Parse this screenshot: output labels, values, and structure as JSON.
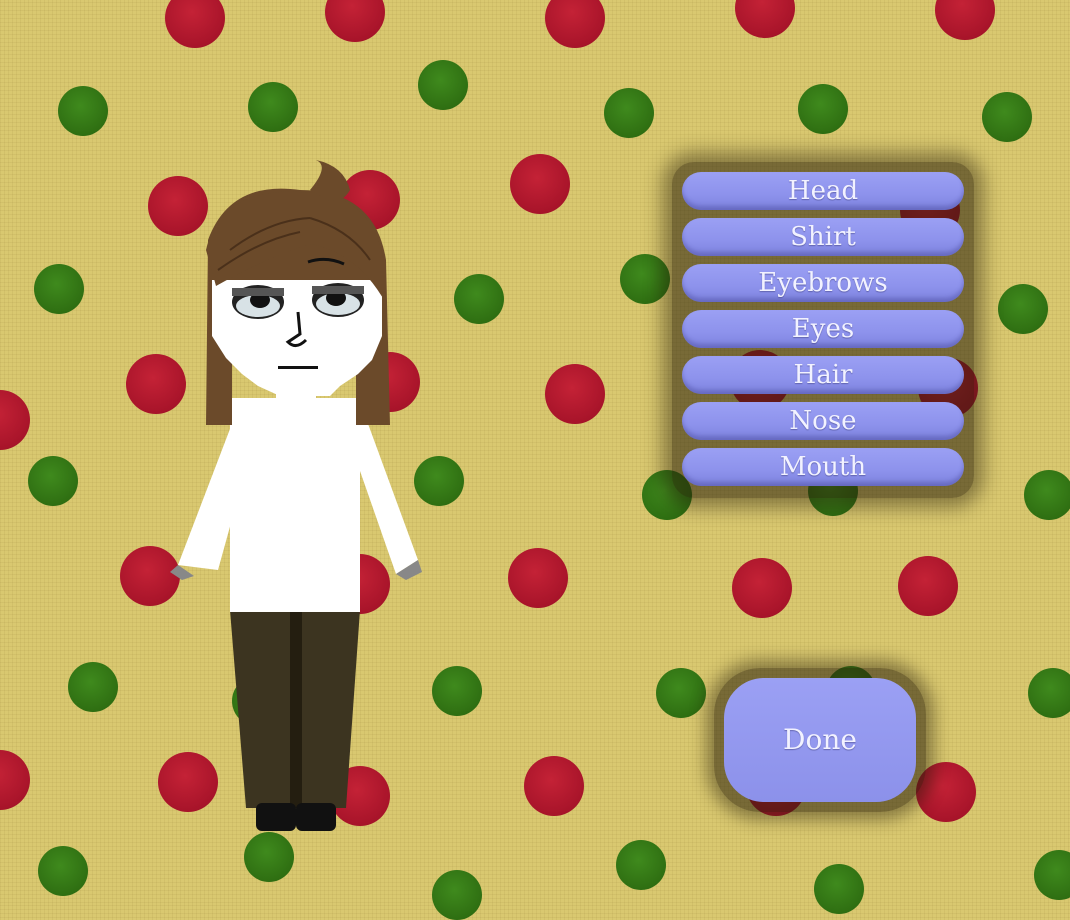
{
  "menu": {
    "items": [
      {
        "label": "Head"
      },
      {
        "label": "Shirt"
      },
      {
        "label": "Eyebrows"
      },
      {
        "label": "Eyes"
      },
      {
        "label": "Hair"
      },
      {
        "label": "Nose"
      },
      {
        "label": "Mouth"
      }
    ]
  },
  "done_label": "Done",
  "colors": {
    "background": "#d9c870",
    "dot_red": "#a8142a",
    "dot_green": "#2f6f12",
    "button_fill": "#8d92ec",
    "button_text": "#f2f2ff",
    "hair": "#6b4a2a",
    "shirt": "#ffffff",
    "pants": "#3c3420",
    "shoes": "#111111"
  }
}
